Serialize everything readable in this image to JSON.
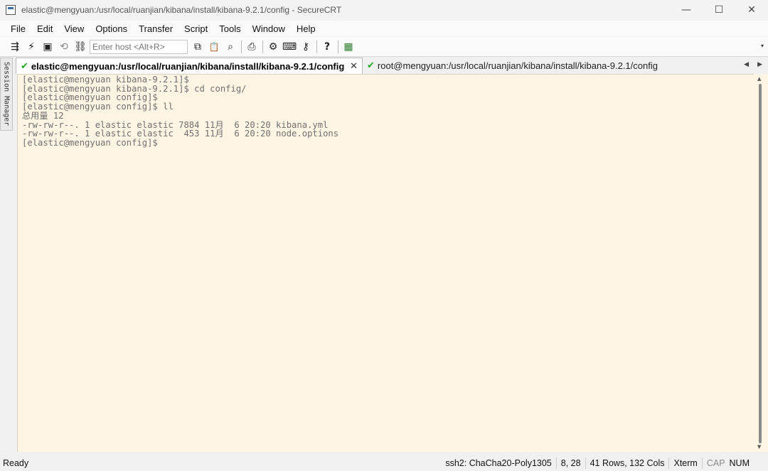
{
  "window": {
    "title": "elastic@mengyuan:/usr/local/ruanjian/kibana/install/kibana-9.2.1/config - SecureCRT",
    "controls": {
      "minimize": "—",
      "maximize": "☐",
      "close": "✕"
    }
  },
  "menu": [
    "File",
    "Edit",
    "View",
    "Options",
    "Transfer",
    "Script",
    "Tools",
    "Window",
    "Help"
  ],
  "toolbar": {
    "host_placeholder": "Enter host <Alt+R>",
    "icons": {
      "connect": "⇶",
      "quick_connect": "⚡",
      "connect_in_tab": "▣",
      "reconnect": "⟲",
      "disconnect": "⛓",
      "copy": "⧉",
      "paste": "📋",
      "find": "⌕",
      "print": "⎙",
      "options": "⚙",
      "keymap": "⌨",
      "sftp": "⚷",
      "help": "?",
      "screen": "▦",
      "dropdown": "▾"
    }
  },
  "session_manager": {
    "label": "Session Manager"
  },
  "tabs": [
    {
      "label": "elastic@mengyuan:/usr/local/ruanjian/kibana/install/kibana-9.2.1/config",
      "active": true,
      "close": "✕"
    },
    {
      "label": "root@mengyuan:/usr/local/ruanjian/kibana/install/kibana-9.2.1/config",
      "active": false
    }
  ],
  "tab_scroll": {
    "left": "◀",
    "right": "▶"
  },
  "terminal": {
    "background": "#fdf4e3",
    "text_color": "#707070",
    "lines": [
      "[elastic@mengyuan kibana-9.2.1]$",
      "[elastic@mengyuan kibana-9.2.1]$ cd config/",
      "[elastic@mengyuan config]$",
      "[elastic@mengyuan config]$ ll",
      "总用量 12",
      "-rw-rw-r--. 1 elastic elastic 7884 11月  6 20:20 kibana.yml",
      "-rw-rw-r--. 1 elastic elastic  453 11月  6 20:20 node.options",
      "[elastic@mengyuan config]$"
    ]
  },
  "scrollbar": {
    "up": "▲",
    "down": "▼"
  },
  "status": {
    "ready": "Ready",
    "cipher": "ssh2: ChaCha20-Poly1305",
    "cursor": "8,  28",
    "size": "41 Rows, 132 Cols",
    "term": "Xterm",
    "cap": "CAP",
    "num": "NUM"
  }
}
